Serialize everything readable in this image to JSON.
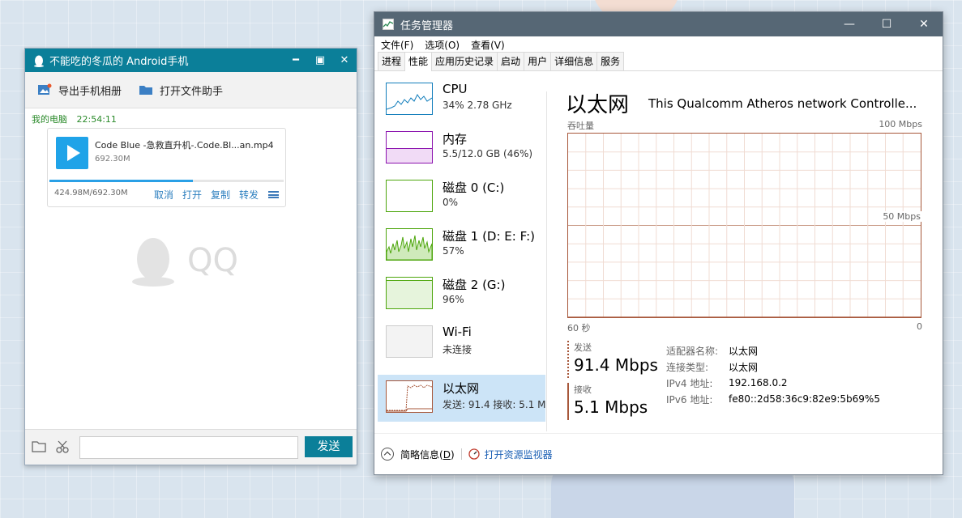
{
  "qq": {
    "title": "不能吃的冬瓜的 Android手机",
    "toolbar": {
      "export_album": "导出手机相册",
      "open_file_helper": "打开文件助手"
    },
    "message": {
      "sender": "我的电脑",
      "time": "22:54:11"
    },
    "file": {
      "name": "Code Blue -急救直升机-.Code.Bl...an.mp4",
      "size": "692.30M",
      "progress_text": "424.98M/692.30M",
      "progress_fraction": 0.614,
      "actions": [
        "取消",
        "打开",
        "复制",
        "转发"
      ]
    },
    "watermark": "QQ",
    "send_label": "发送",
    "accent": "#0b7f99"
  },
  "taskmgr": {
    "title": "任务管理器",
    "menu": [
      "文件(F)",
      "选项(O)",
      "查看(V)"
    ],
    "tabs": [
      "进程",
      "性能",
      "应用历史记录",
      "启动",
      "用户",
      "详细信息",
      "服务"
    ],
    "active_tab": "性能",
    "resources": [
      {
        "name": "CPU",
        "sub": "34%  2.78 GHz",
        "color": "#117dbb"
      },
      {
        "name": "内存",
        "sub": "5.5/12.0 GB (46%)",
        "color": "#8b12ae"
      },
      {
        "name": "磁盘 0 (C:)",
        "sub": "0%",
        "color": "#4da60c"
      },
      {
        "name": "磁盘 1 (D: E: F:)",
        "sub": "57%",
        "color": "#4da60c"
      },
      {
        "name": "磁盘 2 (G:)",
        "sub": "96%",
        "color": "#4da60c"
      },
      {
        "name": "Wi-Fi",
        "sub": "未连接",
        "color": "#aaaaaa"
      },
      {
        "name": "以太网",
        "sub": "发送: 91.4  接收: 5.1 M",
        "color": "#a7573a"
      }
    ],
    "detail": {
      "title": "以太网",
      "adapter": "This Qualcomm Atheros network Controlle...",
      "throughput_label": "吞吐量",
      "max_label": "100 Mbps",
      "mid_label": "50 Mbps",
      "time_left": "60 秒",
      "time_right": "0",
      "send_label": "发送",
      "send_value": "91.4 Mbps",
      "recv_label": "接收",
      "recv_value": "5.1 Mbps",
      "props": [
        {
          "k": "适配器名称:",
          "v": "以太网"
        },
        {
          "k": "连接类型:",
          "v": "以太网"
        },
        {
          "k": "IPv4 地址:",
          "v": "192.168.0.2"
        },
        {
          "k": "IPv6 地址:",
          "v": "fe80::2d58:36c9:82e9:5b69%5"
        }
      ]
    },
    "chart_data": {
      "type": "line",
      "x": [
        60,
        58,
        56,
        54,
        52,
        50,
        48,
        46,
        44,
        42,
        40,
        38,
        36,
        34,
        32,
        30,
        28,
        26,
        24,
        22,
        20,
        18,
        16,
        14,
        12,
        10,
        8,
        6,
        4,
        2,
        0
      ],
      "ylim": [
        0,
        100
      ],
      "series": [
        {
          "name": "发送",
          "style": "dashed",
          "values": [
            0,
            0,
            0,
            0,
            0,
            0,
            0,
            0,
            0,
            0,
            0,
            0,
            0,
            0,
            0,
            0,
            0,
            0,
            0,
            0,
            0,
            0,
            0,
            0,
            0,
            0,
            0,
            0,
            0,
            0,
            0
          ]
        },
        {
          "name": "接收",
          "style": "solid",
          "values": [
            0,
            0,
            0,
            0,
            0,
            0,
            0,
            0,
            0,
            0,
            0,
            0,
            0,
            0,
            0,
            0,
            0,
            0,
            0,
            0,
            0,
            0,
            0,
            0,
            0,
            0,
            0,
            0,
            0,
            0,
            0
          ]
        }
      ]
    }
  }
}
